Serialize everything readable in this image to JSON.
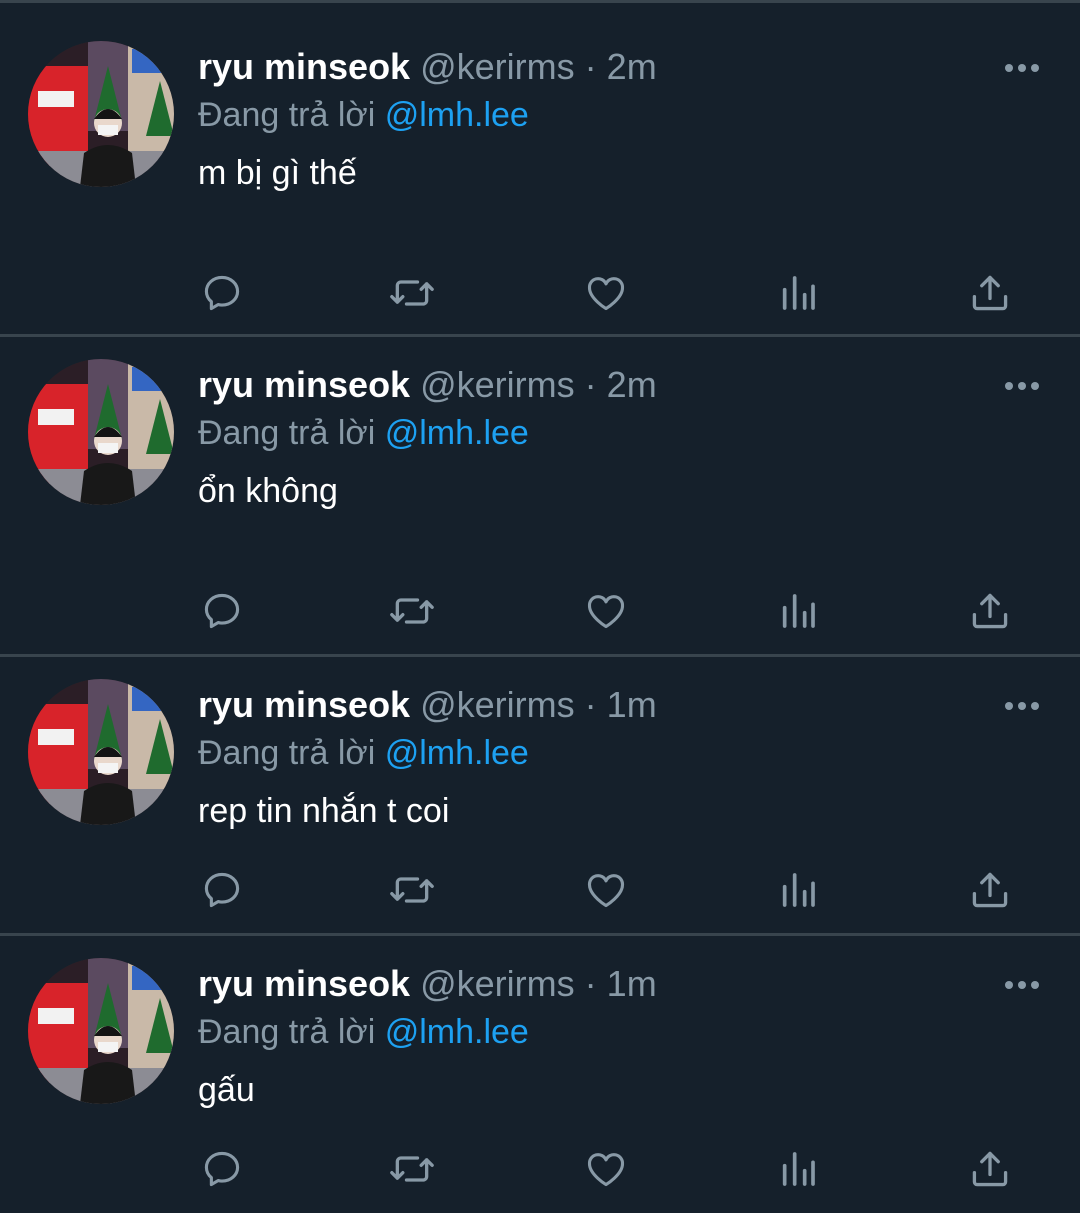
{
  "tweets": [
    {
      "name": "ryu minseok",
      "handle": "@kerirms",
      "separator": "·",
      "time": "2m",
      "reply_prefix": "Đang trả lời",
      "reply_mention": "@lmh.lee",
      "text": "m bị gì thế"
    },
    {
      "name": "ryu minseok",
      "handle": "@kerirms",
      "separator": "·",
      "time": "2m",
      "reply_prefix": "Đang trả lời",
      "reply_mention": "@lmh.lee",
      "text": "ổn không"
    },
    {
      "name": "ryu minseok",
      "handle": "@kerirms",
      "separator": "·",
      "time": "1m",
      "reply_prefix": "Đang trả lời",
      "reply_mention": "@lmh.lee",
      "text": "rep tin nhắn t coi"
    },
    {
      "name": "ryu minseok",
      "handle": "@kerirms",
      "separator": "·",
      "time": "1m",
      "reply_prefix": "Đang trả lời",
      "reply_mention": "@lmh.lee",
      "text": "gấu"
    }
  ],
  "icons": {
    "avatar": "profile-photo",
    "more": "more-horizontal-icon",
    "reply": "reply-bubble-icon",
    "retweet": "retweet-icon",
    "like": "heart-icon",
    "analytics": "analytics-bars-icon",
    "share": "share-upload-icon"
  },
  "colors": {
    "background": "#15202b",
    "divider": "#38444d",
    "text_primary": "#ffffff",
    "text_secondary": "#8899a6",
    "mention": "#1da1f2"
  }
}
